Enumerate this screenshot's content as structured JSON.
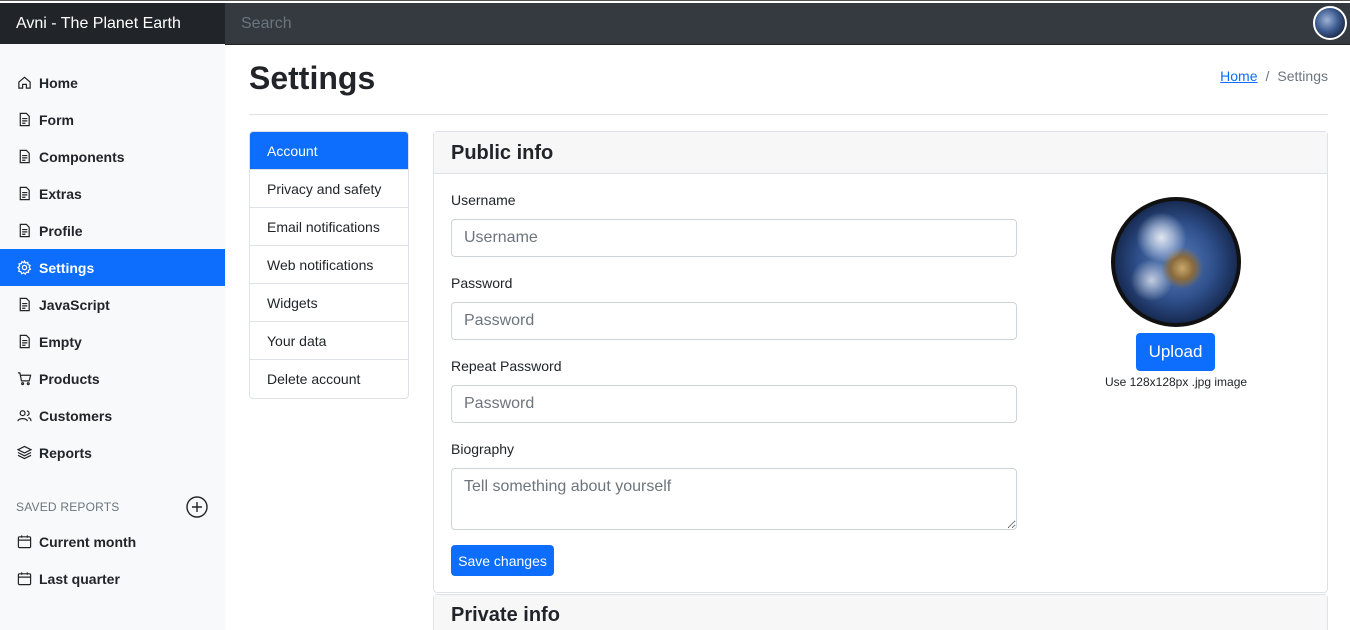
{
  "app": {
    "brand": "Avni - The Planet Earth"
  },
  "search": {
    "placeholder": "Search"
  },
  "sidebar": {
    "items": [
      {
        "label": "Home",
        "icon": "home-icon"
      },
      {
        "label": "Form",
        "icon": "file-icon"
      },
      {
        "label": "Components",
        "icon": "file-icon"
      },
      {
        "label": "Extras",
        "icon": "file-icon"
      },
      {
        "label": "Profile",
        "icon": "file-icon"
      },
      {
        "label": "Settings",
        "icon": "gear-icon",
        "active": true
      },
      {
        "label": "JavaScript",
        "icon": "file-icon"
      },
      {
        "label": "Empty",
        "icon": "file-icon"
      },
      {
        "label": "Products",
        "icon": "cart-icon"
      },
      {
        "label": "Customers",
        "icon": "users-icon"
      },
      {
        "label": "Reports",
        "icon": "layers-icon"
      }
    ],
    "saved_heading": "SAVED REPORTS",
    "saved_items": [
      {
        "label": "Current month",
        "icon": "calendar-icon"
      },
      {
        "label": "Last quarter",
        "icon": "calendar-icon"
      }
    ]
  },
  "page": {
    "title": "Settings",
    "breadcrumb": {
      "home": "Home",
      "separator": "/",
      "current": "Settings"
    }
  },
  "settings_nav": [
    {
      "label": "Account",
      "active": true
    },
    {
      "label": "Privacy and safety"
    },
    {
      "label": "Email notifications"
    },
    {
      "label": "Web notifications"
    },
    {
      "label": "Widgets"
    },
    {
      "label": "Your data"
    },
    {
      "label": "Delete account"
    }
  ],
  "public_info": {
    "heading": "Public info",
    "username_label": "Username",
    "username_placeholder": "Username",
    "password_label": "Password",
    "password_placeholder": "Password",
    "repeat_label": "Repeat Password",
    "repeat_placeholder": "Password",
    "bio_label": "Biography",
    "bio_placeholder": "Tell something about yourself",
    "save_label": "Save changes",
    "upload_label": "Upload",
    "upload_hint": "Use 128x128px .jpg image"
  },
  "private_info": {
    "heading": "Private info"
  },
  "colors": {
    "primary": "#0d6efd",
    "navbar": "#343a40",
    "brand_bg": "#212529",
    "sidebar_bg": "#f8f9fa"
  }
}
